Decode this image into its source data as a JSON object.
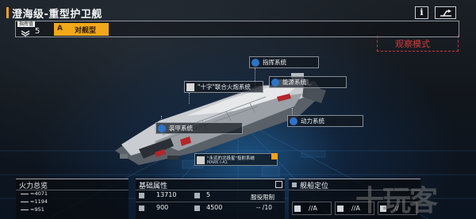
{
  "header": {
    "title": "澄海级-重型护卫舰",
    "info_label": "i"
  },
  "rating": {
    "label": "指挥值",
    "value": "5",
    "class_letter": "A",
    "class_name": "对舰型"
  },
  "observe_mode": "观察模式",
  "systems": {
    "command": "指挥系统",
    "energy": "能源系统",
    "artillery": "\"十字\"联合火炮系统",
    "armor": "装甲系统",
    "power": "动力系统"
  },
  "weapon_sub": {
    "name": "\"永远的北极星\"投射系统",
    "mark": "MARK I-A1"
  },
  "firepower": {
    "title": "火力总览",
    "rows": [
      "=4071",
      "=1194",
      "=951"
    ]
  },
  "attributes": {
    "title": "基础属性",
    "hp": "13710",
    "cost": "5",
    "limit_label": "服役限制",
    "armor": "900",
    "speed": "4500",
    "limit_value": "-- /10"
  },
  "location": {
    "title": "舰船定位",
    "cells": [
      "//A",
      "//A",
      "//"
    ]
  },
  "watermark": "十玩客",
  "colors": {
    "accent_orange": "#f2a818",
    "observe_red": "#d23b3b",
    "system_blue": "#2d74c9"
  }
}
